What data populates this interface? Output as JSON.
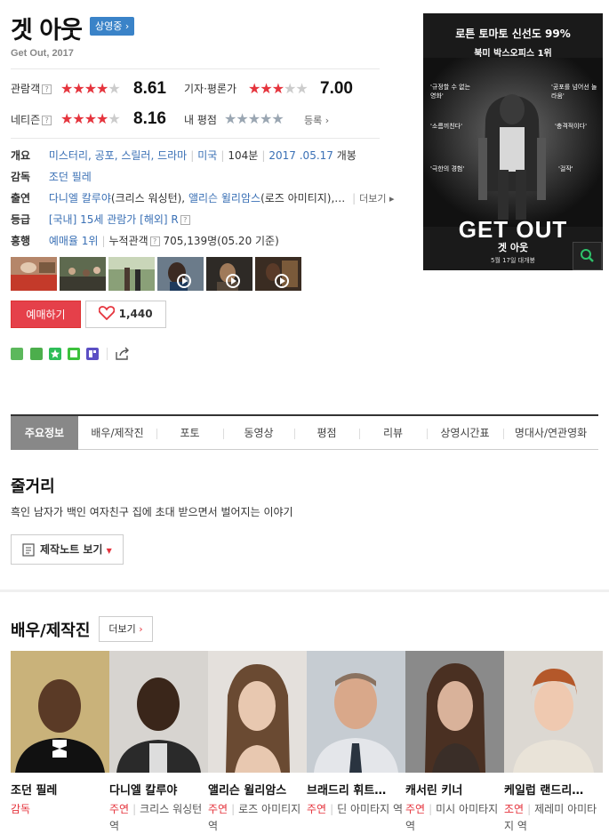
{
  "header": {
    "title": "겟 아웃",
    "status_badge": "상영중",
    "subtitle": "Get Out, 2017"
  },
  "ratings": {
    "audience_label": "관람객",
    "audience_score": "8.61",
    "critic_label": "기자·평론가",
    "critic_score": "7.00",
    "netizen_label": "네티즌",
    "netizen_score": "8.16",
    "my_label": "내 평점",
    "register_label": "등록",
    "stars_full": "★★★★",
    "stars_one": "★",
    "stars_three": "★★★",
    "stars_two": "★★",
    "stars_five": "★★★★★",
    "star_half": "★"
  },
  "info": {
    "overview_label": "개요",
    "genres": "미스터리, 공포, 스릴러, 드라마",
    "country": "미국",
    "runtime": "104분",
    "release_date": "2017 .05.17",
    "release_suffix": "개봉",
    "director_label": "감독",
    "director": "조던 필레",
    "cast_label": "출연",
    "cast_1": "다니엘 칼루야",
    "cast_1_role": "(크리스 워싱턴),",
    "cast_2": "앨리슨 윌리암스",
    "cast_2_role": "(로즈 아미티지),",
    "cast_ellipsis": "…",
    "more_label": "더보기",
    "grade_label": "등급",
    "grade": "[국내] 15세 관람가",
    "grade_intl": "[해외] R",
    "boxoffice_label": "흥행",
    "reservation_rank": "예매율 1위",
    "cumulative_label": "누적관객",
    "cumulative": "705,139명(05.20 기준)"
  },
  "actions": {
    "reserve_label": "예매하기",
    "like_count": "1,440"
  },
  "share_icons": [
    "blog-icon",
    "cafe-icon",
    "star-icon",
    "line-icon",
    "band-icon"
  ],
  "poster": {
    "headline": "로튼 토마토 신선도 99%",
    "subheadline": "북미 박스오피스 1위",
    "title_en": "GET OUT",
    "title_kr": "겟 아웃",
    "date": "5월 17일 대개봉",
    "quotes": [
      "'규정할 수 없는 영화'",
      "'공포를 넘어선 놀라움'",
      "'소름끼친다'",
      "'충격적이다'",
      "'극한의 경험'",
      "'걸작'"
    ]
  },
  "tabs": [
    "주요정보",
    "배우/제작진",
    "포토",
    "동영상",
    "평점",
    "리뷰",
    "상영시간표",
    "명대사/연관영화"
  ],
  "synopsis": {
    "heading": "줄거리",
    "text": "흑인 남자가 백인 여자친구 집에 초대 받으면서 벌어지는 이야기",
    "notes_button": "제작노트 보기"
  },
  "cast_section": {
    "heading": "배우/제작진",
    "more_label": "더보기",
    "people": [
      {
        "name": "조던 필레",
        "type": "감독",
        "role": ""
      },
      {
        "name": "다니엘 칼루야",
        "type": "주연",
        "role": "크리스 워싱턴 역"
      },
      {
        "name": "앨리슨 윌리암스",
        "type": "주연",
        "role": "로즈 아미티지 역"
      },
      {
        "name": "브래드리 휘트…",
        "type": "주연",
        "role": "딘 아미타지 역"
      },
      {
        "name": "캐서린 키너",
        "type": "주연",
        "role": "미시 아미타지 역"
      },
      {
        "name": "케일럽 랜드리…",
        "type": "조연",
        "role": "제레미 아미타지 역"
      }
    ]
  },
  "colors": {
    "accent_red": "#e5343d",
    "link_blue": "#3a70b5",
    "badge_blue": "#3a83c8"
  }
}
